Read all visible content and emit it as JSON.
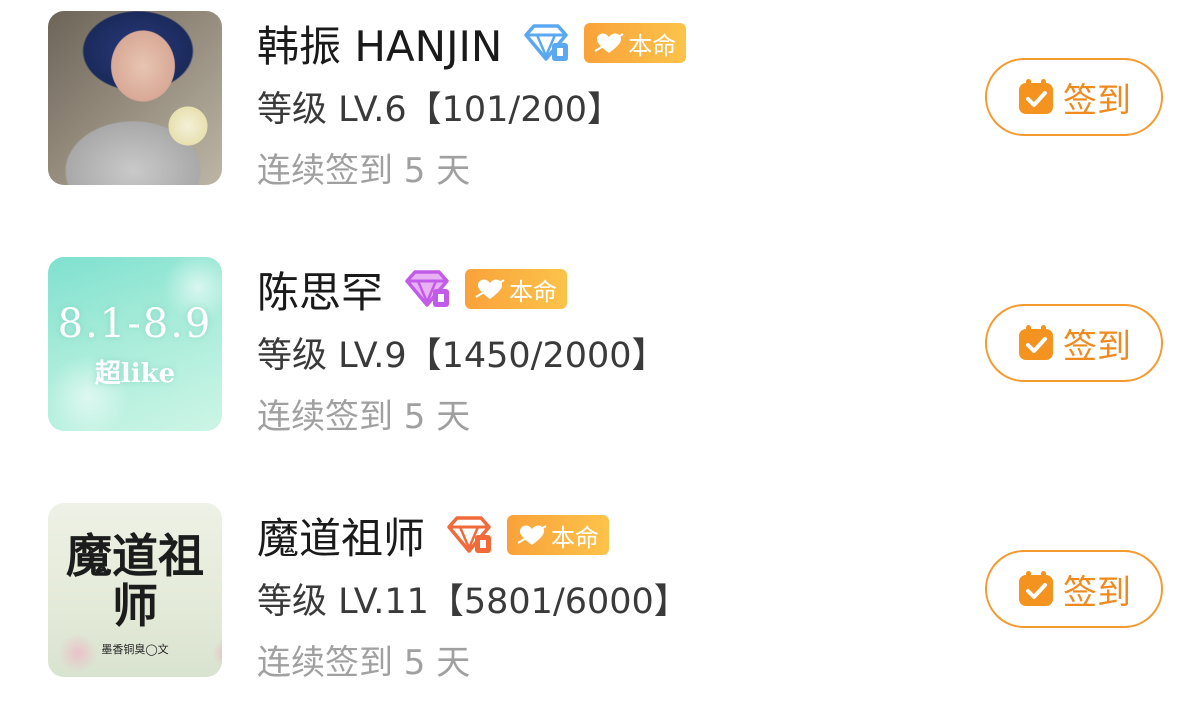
{
  "checkin_color": "#f49a2f",
  "tag_colors": [
    "#f9a23a",
    "#fcc34a"
  ],
  "communities": [
    {
      "name": "韩振 HANJIN",
      "badge_icon": "diamond-blue-icon",
      "badge_color": "#5aa9f0",
      "tag_icon": "heart-arrow-icon",
      "tag_label": "本命",
      "level_text": "等级 LV.6【101/200】",
      "streak_text": "连续签到 5 天",
      "checkin_label": "签到",
      "avatar_text": "",
      "avatar_subtext": ""
    },
    {
      "name": "陈思罕",
      "badge_icon": "diamond-purple-icon",
      "badge_color": "#c25be8",
      "tag_icon": "heart-arrow-icon",
      "tag_label": "本命",
      "level_text": "等级 LV.9【1450/2000】",
      "streak_text": "连续签到 5 天",
      "checkin_label": "签到",
      "avatar_text": "8.1-8.9",
      "avatar_subtext": "超like"
    },
    {
      "name": "魔道祖师",
      "badge_icon": "diamond-orange-icon",
      "badge_color": "#f06a3a",
      "tag_icon": "heart-arrow-icon",
      "tag_label": "本命",
      "level_text": "等级 LV.11【5801/6000】",
      "streak_text": "连续签到 5 天",
      "checkin_label": "签到",
      "avatar_text": "魔道祖师",
      "avatar_subtext": "墨香铜臭◯文"
    }
  ]
}
